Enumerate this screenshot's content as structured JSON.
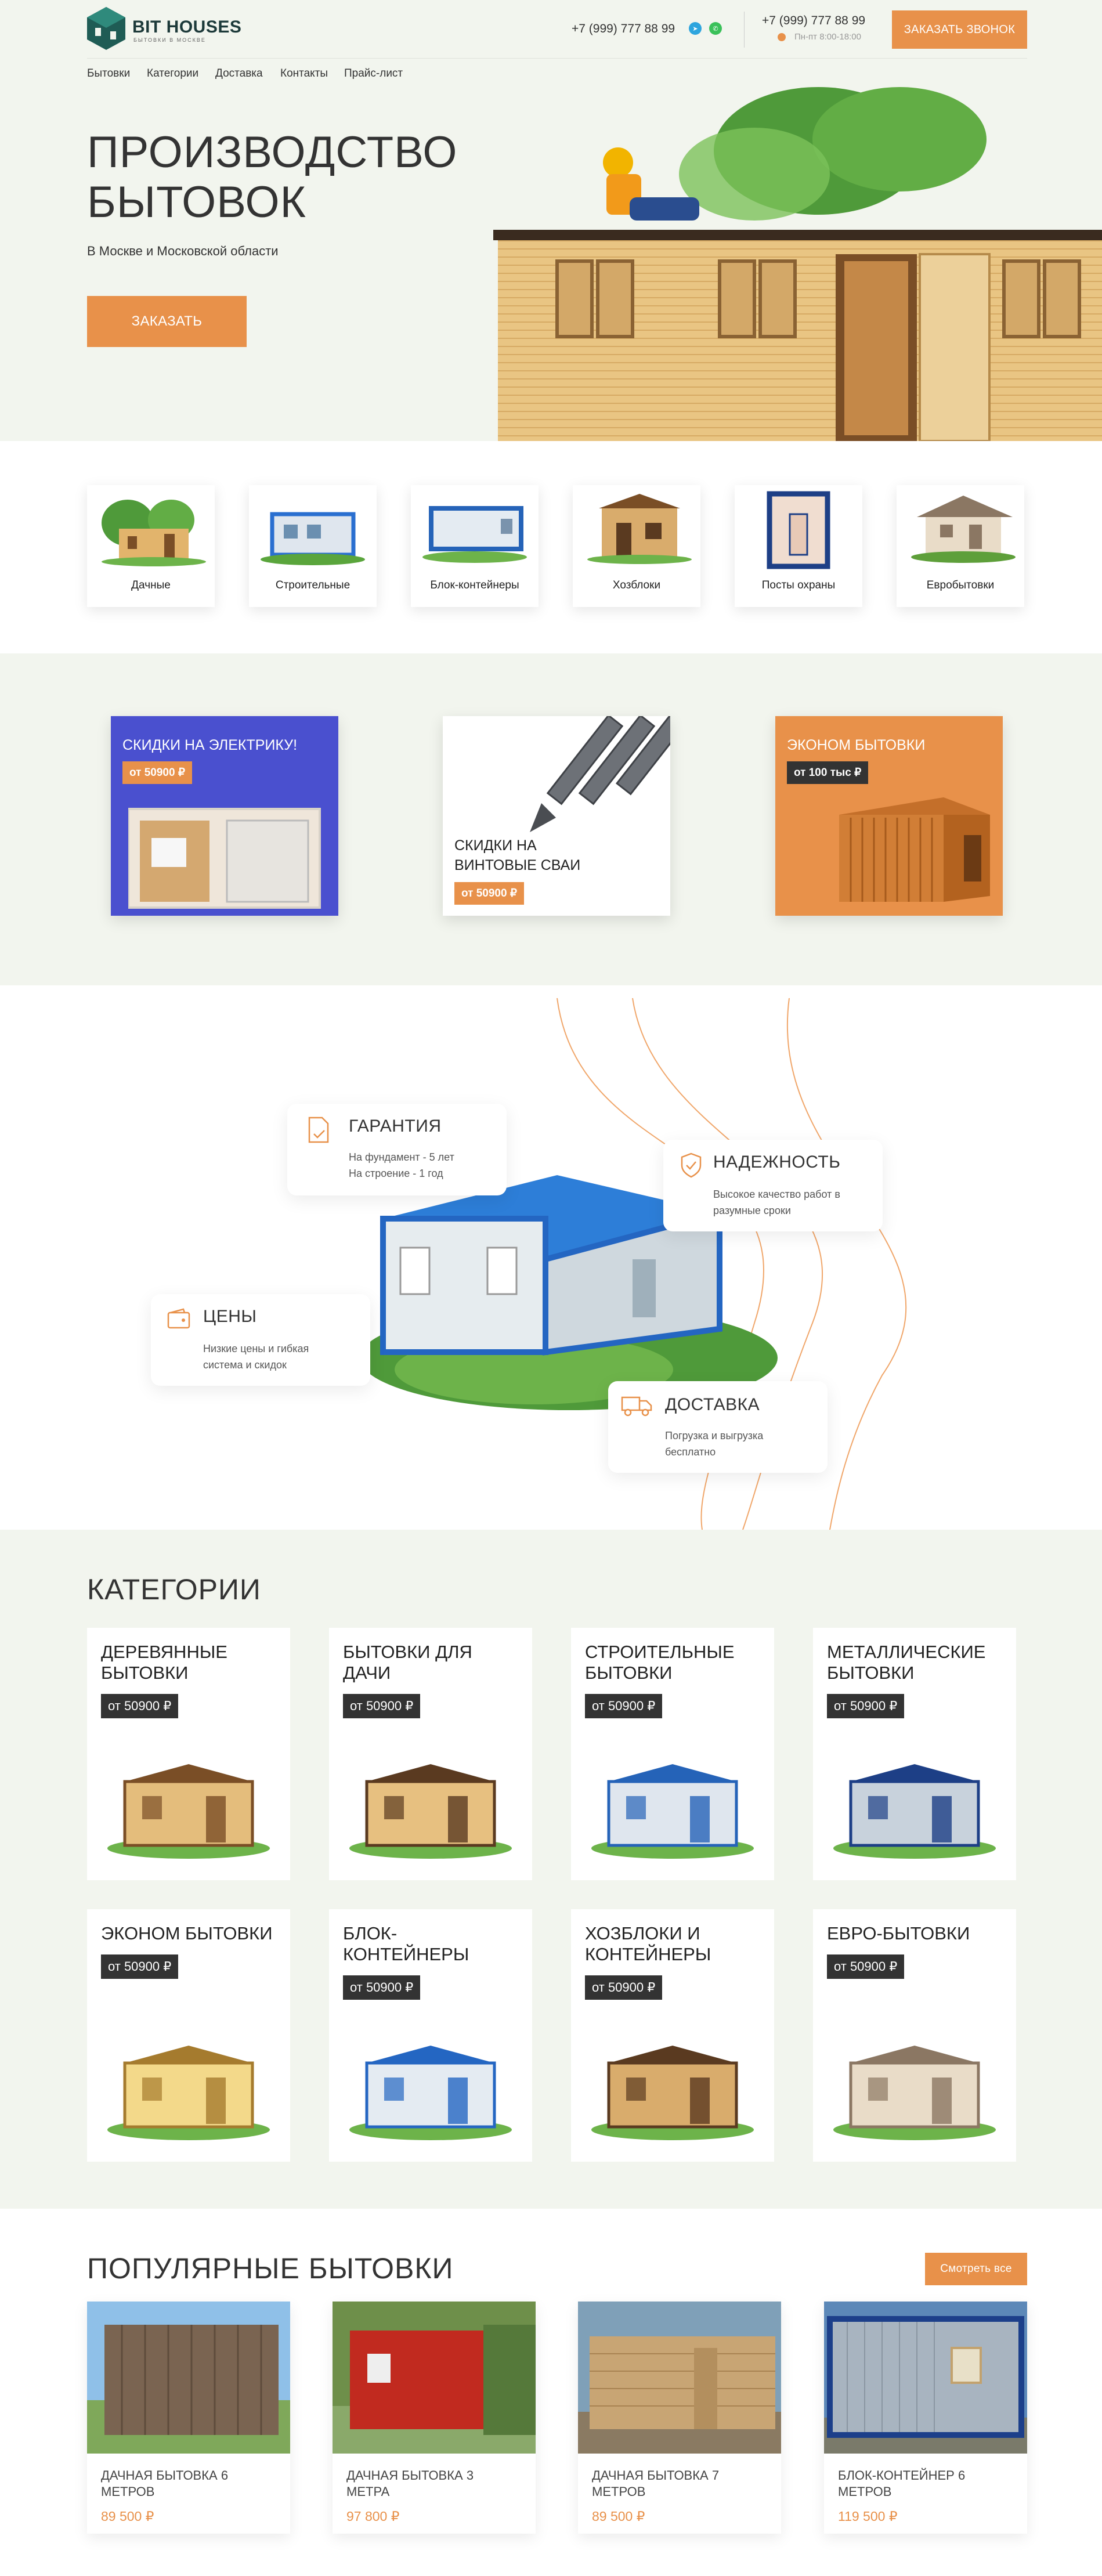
{
  "header": {
    "logo_title": "BIT HOUSES",
    "logo_subtitle": "бытовки в москве",
    "phone_main": "+7 (999) 777 88 99",
    "phone_second": "+7 (999) 777 88 99",
    "hours": "Пн-пт 8:00-18:00",
    "callback_button": "ЗАКАЗАТЬ ЗВОНОК",
    "nav": [
      "Бытовки",
      "Категории",
      "Доставка",
      "Контакты",
      "Прайс-лист"
    ]
  },
  "hero": {
    "title_line1": "ПРОИЗВОДСТВО",
    "title_line2": "БЫТОВОК",
    "subtitle": "В Москве и Московской области",
    "order_button": "ЗАКАЗАТЬ"
  },
  "category_tiles": [
    "Дачные",
    "Строительные",
    "Блок-контейнеры",
    "Хозблоки",
    "Посты охраны",
    "Евробытовки"
  ],
  "promos": [
    {
      "title": "СКИДКИ НА ЭЛЕКТРИКУ!",
      "price": "от 50900 ₽",
      "color": "#4a50cf"
    },
    {
      "title_line1": "СКИДКИ НА",
      "title_line2": "ВИНТОВЫЕ СВАИ",
      "price": "от 50900 ₽"
    },
    {
      "title": "ЭКОНОМ БЫТОВКИ",
      "price": "от 100 тыс ₽",
      "color": "#e8914a"
    }
  ],
  "features": {
    "guarantee": {
      "title": "ГАРАНТИЯ",
      "line1": "На фундамент - 5 лет",
      "line2": "На строение - 1 год"
    },
    "reliability": {
      "title": "НАДЕЖНОСТЬ",
      "line1": "Высокое качество работ в",
      "line2": "разумные сроки"
    },
    "prices": {
      "title": "ЦЕНЫ",
      "line1": "Низкие цены и гибкая",
      "line2": "система и скидок"
    },
    "delivery": {
      "title": "ДОСТАВКА",
      "line1": "Погрузка и выгрузка",
      "line2": "бесплатно"
    }
  },
  "categories": {
    "title": "КАТЕГОРИИ",
    "items": [
      {
        "line1": "ДЕРЕВЯННЫЕ",
        "line2": "БЫТОВКИ",
        "price": "от 50900 ₽"
      },
      {
        "line1": "БЫТОВКИ ДЛЯ",
        "line2": "ДАЧИ",
        "price": "от 50900 ₽"
      },
      {
        "line1": "СТРОИТЕЛЬНЫЕ",
        "line2": "БЫТОВКИ",
        "price": "от 50900 ₽"
      },
      {
        "line1": "МЕТАЛЛИЧЕСКИЕ",
        "line2": "БЫТОВКИ",
        "price": "от 50900 ₽"
      },
      {
        "line1": "ЭКОНОМ БЫТОВКИ",
        "line2": "",
        "price": "от 50900 ₽"
      },
      {
        "line1": "БЛОК-",
        "line2": "КОНТЕЙНЕРЫ",
        "price": "от 50900 ₽"
      },
      {
        "line1": "ХОЗБЛОКИ И",
        "line2": "КОНТЕЙНЕРЫ",
        "price": "от 50900 ₽"
      },
      {
        "line1": "ЕВРО-БЫТОВКИ",
        "line2": "",
        "price": "от 50900 ₽"
      }
    ]
  },
  "popular": {
    "title": "ПОПУЛЯРНЫЕ БЫТОВКИ",
    "see_all": "Смотреть все",
    "items": [
      {
        "line1": "ДАЧНАЯ БЫТОВКА 6",
        "line2": "МЕТРОВ",
        "price": "89 500 ₽"
      },
      {
        "line1": "ДАЧНАЯ БЫТОВКА 3",
        "line2": "МЕТРА",
        "price": "97 800 ₽"
      },
      {
        "line1": "ДАЧНАЯ БЫТОВКА 7",
        "line2": "МЕТРОВ",
        "price": "89 500 ₽"
      },
      {
        "line1": "БЛОК-КОНТЕЙНЕР 6",
        "line2": "МЕТРОВ",
        "price": "119 500 ₽"
      }
    ]
  },
  "colors": {
    "accent": "#e8914a",
    "bg_light": "#f2f5ee",
    "dark": "#333333",
    "promo_blue": "#4a50cf"
  }
}
